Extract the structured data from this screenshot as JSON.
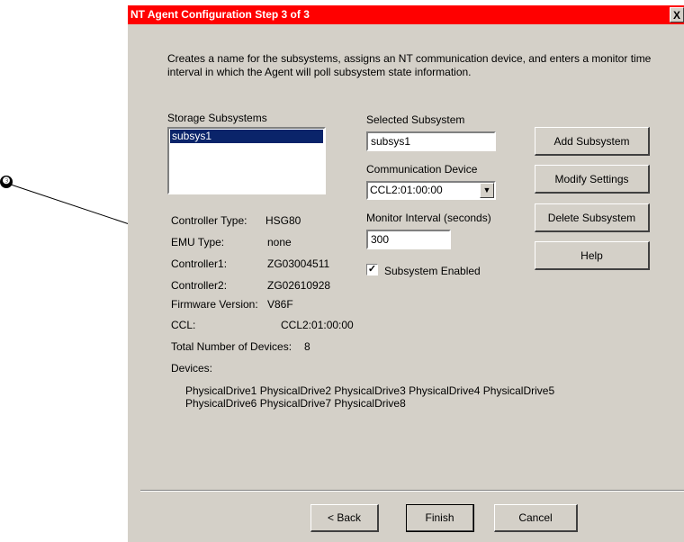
{
  "dialog": {
    "title": "NT Agent Configuration Step 3 of 3",
    "close_label": "X",
    "description": "Creates a name for the subsystems, assigns an NT communication device, and enters a monitor time interval in which the Agent will poll subsystem state information."
  },
  "storage_subsystems": {
    "label": "Storage Subsystems",
    "items": [
      "subsys1"
    ]
  },
  "selected_subsystem": {
    "label": "Selected Subsystem",
    "value": "subsys1"
  },
  "communication_device": {
    "label": "Communication Device",
    "value": "CCL2:01:00:00"
  },
  "monitor_interval": {
    "label": "Monitor Interval (seconds)",
    "value": "300"
  },
  "subsystem_enabled": {
    "label": "Subsystem Enabled",
    "checked": true
  },
  "actions": {
    "add": "Add Subsystem",
    "modify": "Modify Settings",
    "delete": "Delete Subsystem",
    "help": "Help"
  },
  "info": {
    "controller_type_label": "Controller Type:",
    "controller_type": "HSG80",
    "emu_type_label": "EMU Type:",
    "emu_type": "none",
    "controller1_label": "Controller1:",
    "controller1": "ZG03004511",
    "controller2_label": "Controller2:",
    "controller2": "ZG02610928",
    "firmware_label": "Firmware Version:",
    "firmware": "V86F",
    "ccl_label": "CCL:",
    "ccl": "CCL2:01:00:00",
    "total_devices_label": "Total Number of Devices:",
    "total_devices": "8",
    "devices_label": "Devices:",
    "devices_line1": "PhysicalDrive1 PhysicalDrive2 PhysicalDrive3 PhysicalDrive4 PhysicalDrive5",
    "devices_line2": "PhysicalDrive6 PhysicalDrive7 PhysicalDrive8"
  },
  "footer": {
    "back": "< Back",
    "finish": "Finish",
    "cancel": "Cancel"
  },
  "callout": {
    "marker": "❸"
  }
}
